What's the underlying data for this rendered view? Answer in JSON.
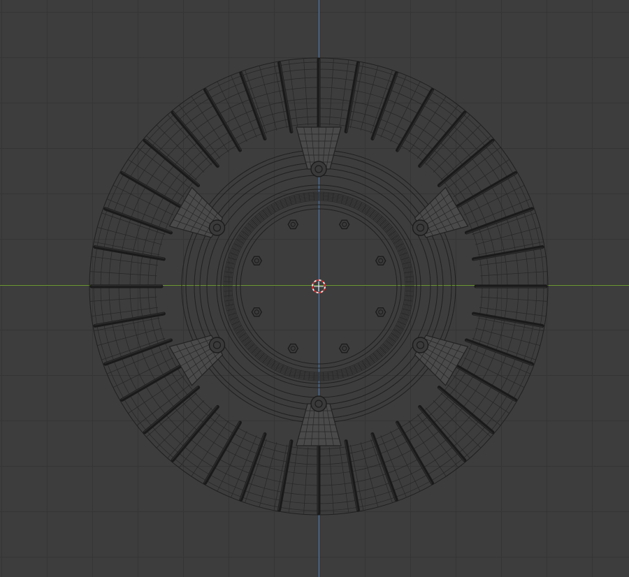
{
  "viewport": {
    "background_color": "#3d3d3d",
    "grid_color": "#353535",
    "x_axis_color": "#6f9b33",
    "y_axis_color": "#4f86c9",
    "wire_color": "#202020"
  },
  "object": {
    "tread_count": 36,
    "pad_count": 6,
    "hub_bolt_count": 8
  }
}
